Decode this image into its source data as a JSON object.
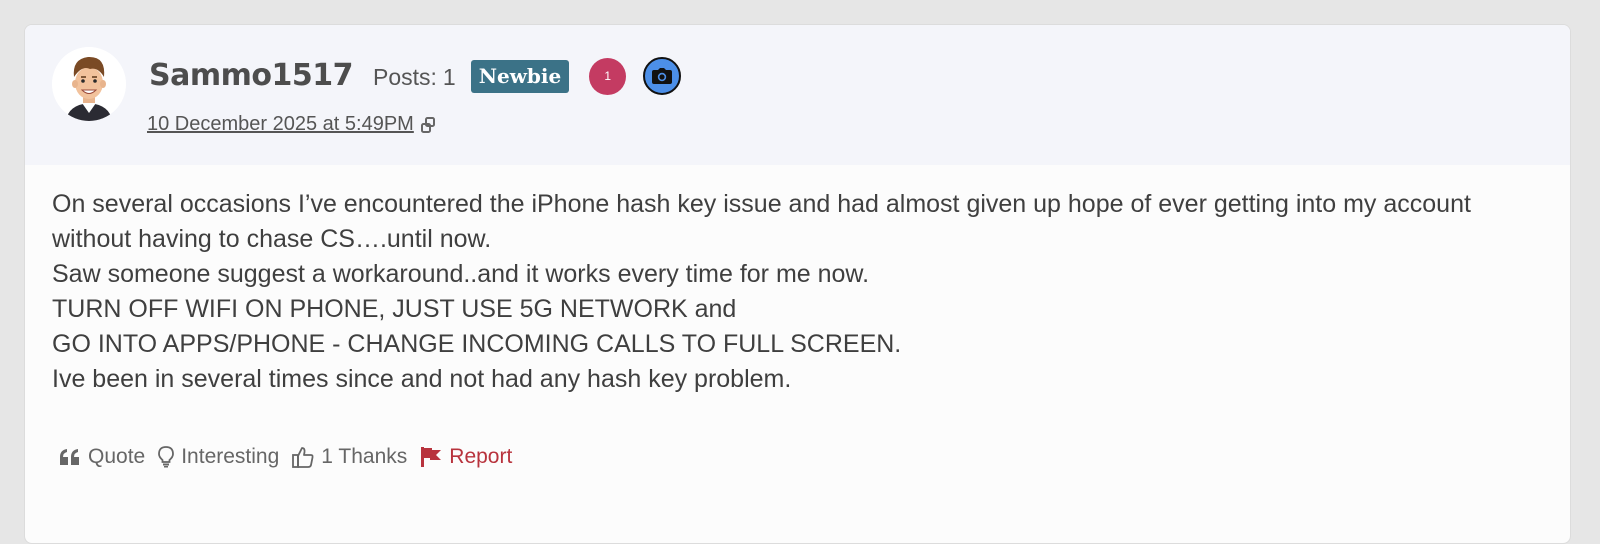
{
  "post": {
    "author": {
      "username": "Sammo1517",
      "posts_label": "Posts:",
      "posts_count": "1",
      "rank": "Newbie",
      "notification_count": "1",
      "avatar_icon": "cartoon-man-avatar",
      "badge_icon": "camera-icon"
    },
    "timestamp": "10 December 2025 at 5:49PM",
    "body": {
      "p1": "On several occasions I’ve encountered the iPhone hash key issue and had almost given up hope of ever getting into my account without having to chase CS….until now.",
      "p2": "Saw someone suggest a workaround..and it works every time for me now.",
      "p3": "TURN OFF WIFI ON PHONE, JUST USE 5G NETWORK and",
      "p4": "GO INTO APPS/PHONE - CHANGE INCOMING CALLS TO FULL SCREEN.",
      "p5": "Ive been in several times since and not had any hash key problem."
    },
    "actions": {
      "quote": "Quote",
      "interesting": "Interesting",
      "thanks": "1 Thanks",
      "report": "Report"
    }
  },
  "colors": {
    "page_bg": "#e6e6e6",
    "header_bg": "#f4f5fa",
    "rank_badge": "#3b7287",
    "notification": "#c43b62",
    "camera_badge": "#4c8fe8",
    "report": "#b8333d"
  }
}
